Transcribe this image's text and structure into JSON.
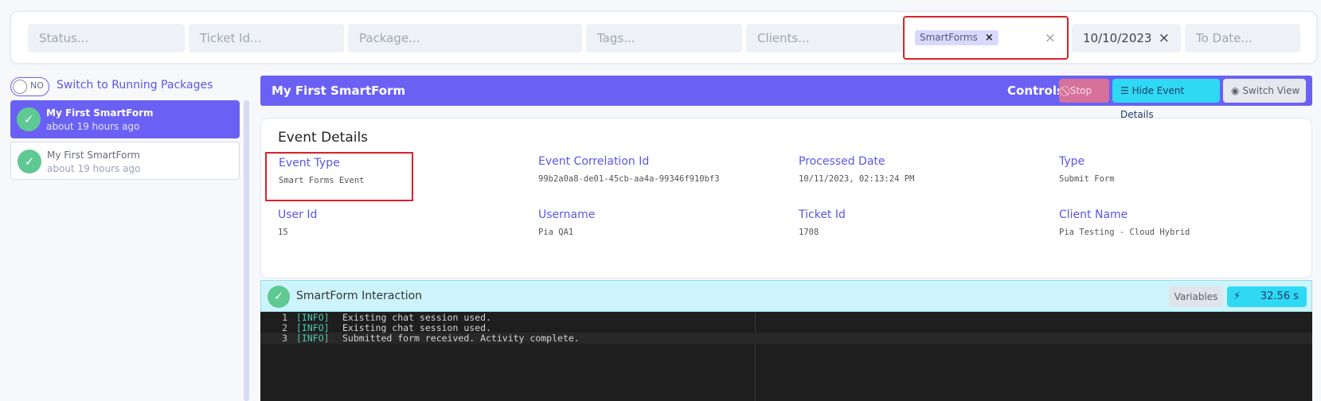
{
  "filters": {
    "status_placeholder": "Status...",
    "ticket_placeholder": "Ticket Id...",
    "package_placeholder": "Package...",
    "tags_placeholder": "Tags...",
    "clients_placeholder": "Clients...",
    "selected_package_chip": "SmartForms",
    "chip_remove": "×",
    "clear_glyph": "×",
    "from_date": "10/10/2023",
    "to_date_placeholder": "To Date..."
  },
  "toggle": {
    "state": "NO",
    "label": "Switch to Running Packages"
  },
  "packages": [
    {
      "name": "My First SmartForm",
      "time": "about 19 hours ago",
      "active": true
    },
    {
      "name": "My First SmartForm",
      "time": "about 19 hours ago",
      "active": false
    }
  ],
  "header": {
    "title": "My First SmartForm",
    "controls_label": "Controls",
    "stop_label": "Stop",
    "hide_label": "Hide Event Details",
    "switch_label": "Switch View"
  },
  "details": {
    "title": "Event Details",
    "fields": [
      {
        "key": "Event Type",
        "value": "Smart Forms Event"
      },
      {
        "key": "Event Correlation Id",
        "value": "99b2a0a8-de01-45cb-aa4a-99346f910bf3"
      },
      {
        "key": "Processed Date",
        "value": "10/11/2023, 02:13:24 PM"
      },
      {
        "key": "Type",
        "value": "Submit Form"
      },
      {
        "key": "User Id",
        "value": "15"
      },
      {
        "key": "Username",
        "value": "Pia QA1"
      },
      {
        "key": "Ticket Id",
        "value": "1708"
      },
      {
        "key": "Client Name",
        "value": "Pia Testing - Cloud Hybrid"
      }
    ]
  },
  "interaction": {
    "title": "SmartForm Interaction",
    "variables_label": "Variables",
    "duration": "32.56 s",
    "log": [
      {
        "n": "1",
        "tag": "[INFO]",
        "msg": "Existing chat session used."
      },
      {
        "n": "2",
        "tag": "[INFO]",
        "msg": "Existing chat session used."
      },
      {
        "n": "3",
        "tag": "[INFO]",
        "msg": "Submitted form received. Activity complete."
      }
    ]
  },
  "colors": {
    "accent": "#6a61f4",
    "success": "#5ec993",
    "highlight_border": "#d9222a",
    "cyan": "#2fd8f3"
  }
}
